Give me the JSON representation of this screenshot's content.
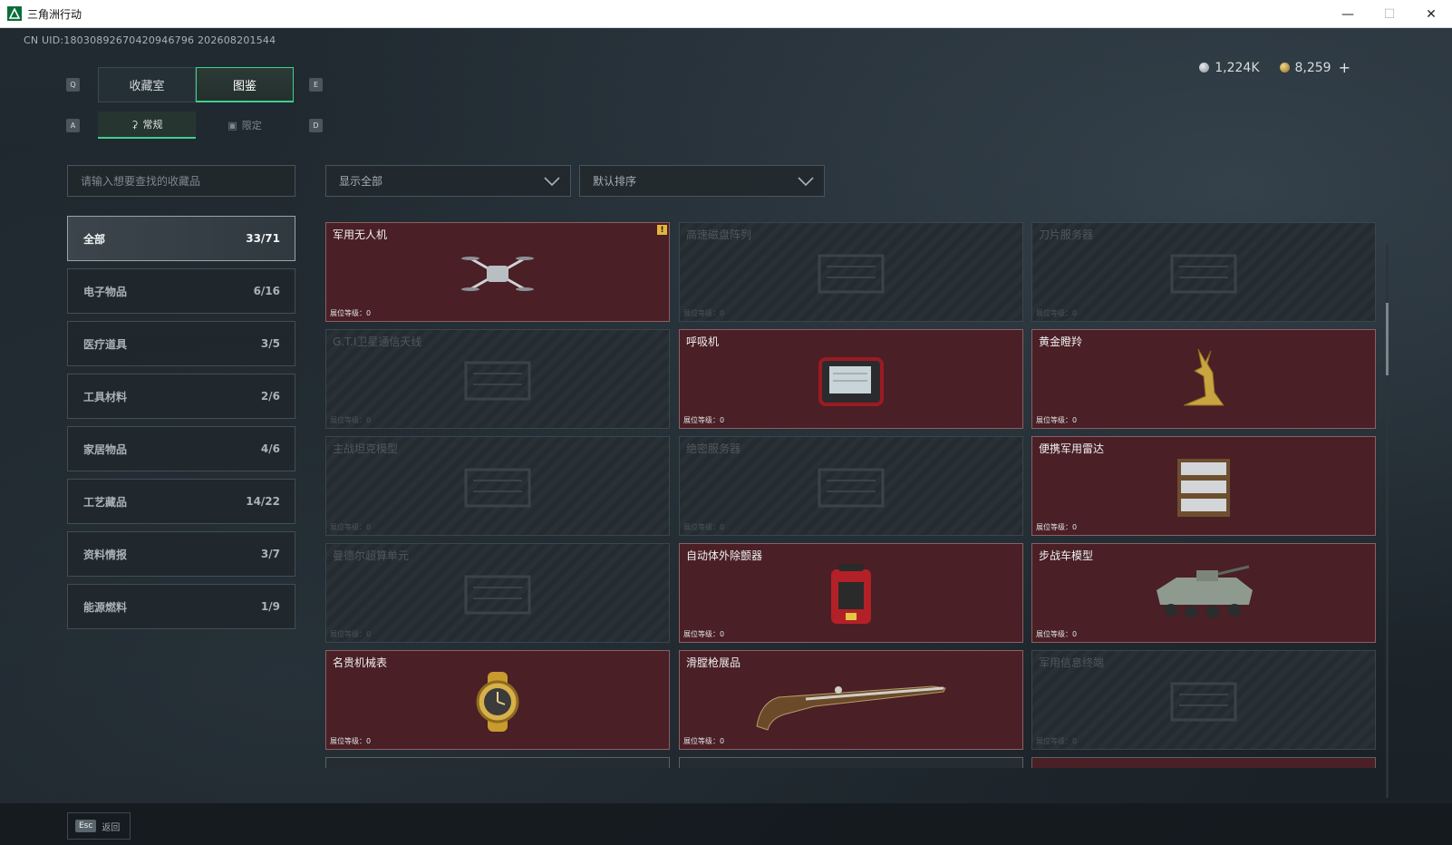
{
  "window": {
    "title": "三角洲行动"
  },
  "uid_text": "CN UID:18030892670420946796 202608201544",
  "currency": {
    "silver": "1,224K",
    "gold": "8,259",
    "add": "+"
  },
  "tabs_main": {
    "key_left": "Q",
    "key_right": "E",
    "items": [
      "收藏室",
      "图鉴"
    ],
    "active": 1
  },
  "tabs_sub": {
    "key_left": "A",
    "key_right": "D",
    "items": [
      "常规",
      "限定"
    ],
    "active": 0
  },
  "search": {
    "placeholder": "请输入想要查找的收藏品"
  },
  "filters": {
    "show": "显示全部",
    "sort": "默认排序"
  },
  "categories": [
    {
      "label": "全部",
      "count": "33/71"
    },
    {
      "label": "电子物品",
      "count": "6/16"
    },
    {
      "label": "医疗道具",
      "count": "3/5"
    },
    {
      "label": "工具材料",
      "count": "2/6"
    },
    {
      "label": "家居物品",
      "count": "4/6"
    },
    {
      "label": "工艺藏品",
      "count": "14/22"
    },
    {
      "label": "资料情报",
      "count": "3/7"
    },
    {
      "label": "能源燃料",
      "count": "1/9"
    }
  ],
  "level_label": "展位等级：",
  "items": [
    {
      "name": "军用无人机",
      "level": "0",
      "owned": true,
      "alert": "!",
      "icon": "drone-icon"
    },
    {
      "name": "高速磁盘阵列",
      "level": "0",
      "owned": false,
      "icon": "disk-array-icon"
    },
    {
      "name": "刀片服务器",
      "level": "0",
      "owned": false,
      "icon": "blade-server-icon"
    },
    {
      "name": "G.T.I卫星通信天线",
      "level": "0",
      "owned": false,
      "icon": "satellite-dish-icon"
    },
    {
      "name": "呼吸机",
      "level": "0",
      "owned": true,
      "icon": "ventilator-icon"
    },
    {
      "name": "黄金瞪羚",
      "level": "0",
      "owned": true,
      "icon": "golden-gazelle-icon"
    },
    {
      "name": "主战坦克模型",
      "level": "0",
      "owned": false,
      "icon": "tank-model-icon"
    },
    {
      "name": "绝密服务器",
      "level": "0",
      "owned": false,
      "icon": "server-icon"
    },
    {
      "name": "便携军用雷达",
      "level": "0",
      "owned": true,
      "icon": "radar-icon"
    },
    {
      "name": "曼德尔超算单元",
      "level": "0",
      "owned": false,
      "icon": "supercomputer-icon"
    },
    {
      "name": "自动体外除颤器",
      "level": "0",
      "owned": true,
      "icon": "defibrillator-icon"
    },
    {
      "name": "步战车模型",
      "level": "0",
      "owned": true,
      "icon": "ifv-model-icon"
    },
    {
      "name": "名贵机械表",
      "level": "0",
      "owned": true,
      "icon": "watch-icon"
    },
    {
      "name": "滑膛枪展品",
      "level": "0",
      "owned": true,
      "icon": "musket-icon"
    },
    {
      "name": "军用信息终端",
      "level": "0",
      "owned": false,
      "icon": "terminal-icon"
    }
  ],
  "partial_row": [
    {
      "name": "...",
      "owned": false
    },
    {
      "name": "...",
      "owned": false
    },
    {
      "name": "...",
      "owned": true
    }
  ],
  "bottom": {
    "esc_key": "Esc",
    "back_label": "返回"
  },
  "colors": {
    "accent": "#3fd08c",
    "owned_card": "#4a1f25",
    "background": "#1e262c"
  }
}
